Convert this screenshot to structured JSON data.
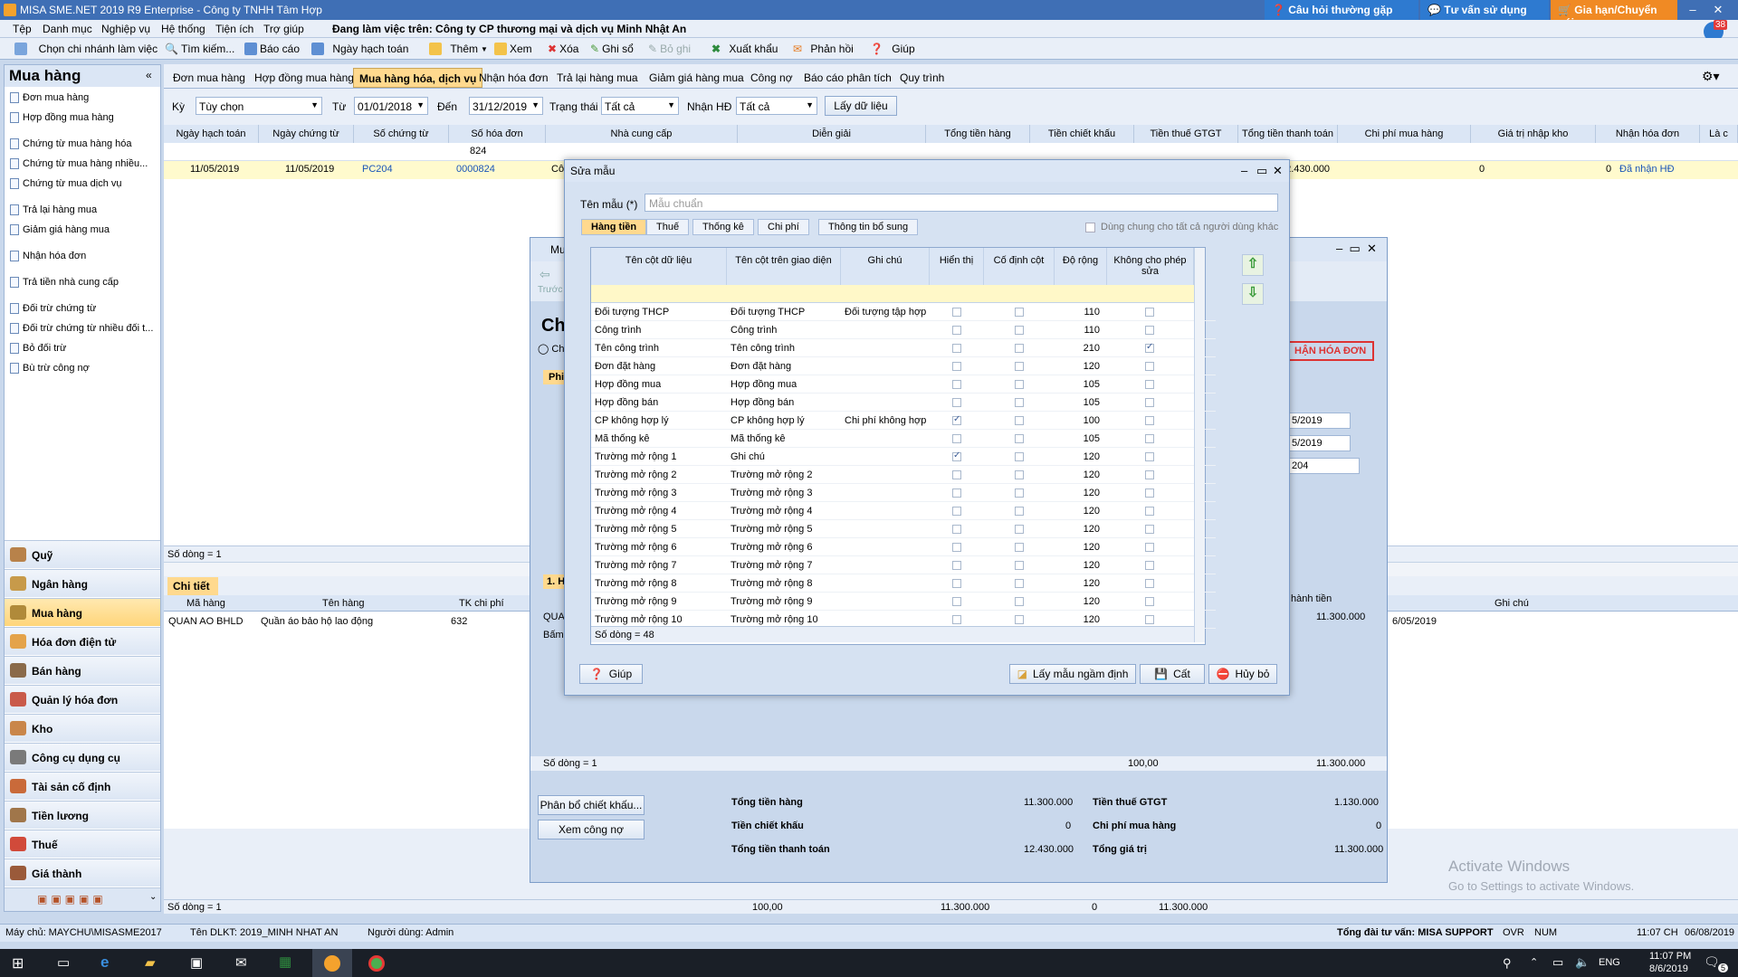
{
  "app": {
    "title": "MISA SME.NET 2019 R9 Enterprise - Công ty TNHH Tâm Hợp",
    "faq_label": "Câu hỏi thường gặp",
    "consult_label": "Tư vấn sử dụng",
    "renew_label": "Gia hạn/Chuyển gói",
    "working_on": "Đang làm việc trên: Công ty CP thương mại và dịch vụ Minh Nhật An",
    "notification_count": "38"
  },
  "menu": [
    "Tệp",
    "Danh mục",
    "Nghiệp vụ",
    "Hệ thống",
    "Tiện ích",
    "Trợ giúp"
  ],
  "toolbar": [
    "Chọn chi nhánh làm việc",
    "Tìm kiếm...",
    "Báo cáo",
    "Ngày hạch toán",
    "Thêm",
    "Xem",
    "Xóa",
    "Ghi sổ",
    "Bỏ ghi",
    "Xuất khẩu",
    "Phản hồi",
    "Giúp"
  ],
  "left": {
    "title": "Mua hàng",
    "items": [
      "Đơn mua hàng",
      "Hợp đồng mua hàng",
      "Chứng từ mua hàng hóa",
      "Chứng từ mua hàng nhiều...",
      "Chứng từ mua dịch vụ",
      "Trả lại hàng mua",
      "Giảm giá hàng mua",
      "Nhận hóa đơn",
      "Trả tiền nhà cung cấp",
      "Đối trừ chứng từ",
      "Đối trừ chứng từ nhiều đối t...",
      "Bỏ đối trừ",
      "Bù trừ công nợ"
    ],
    "modules": [
      "Quỹ",
      "Ngân hàng",
      "Mua hàng",
      "Hóa đơn điện tử",
      "Bán hàng",
      "Quản lý hóa đơn",
      "Kho",
      "Công cụ dụng cụ",
      "Tài sản cố định",
      "Tiền lương",
      "Thuế",
      "Giá thành"
    ]
  },
  "tabs": [
    "Đơn mua hàng",
    "Hợp đồng mua hàng",
    "Mua hàng hóa, dịch vụ",
    "Nhận hóa đơn",
    "Trả lại hàng mua",
    "Giảm giá hàng mua",
    "Công nợ",
    "Báo cáo phân tích",
    "Quy trình"
  ],
  "filter": {
    "ky_label": "Kỳ",
    "ky_value": "Tùy chọn",
    "tu_label": "Từ",
    "tu_value": "01/01/2018",
    "den_label": "Đến",
    "den_value": "31/12/2019",
    "trangthai_label": "Trạng thái",
    "trangthai_value": "Tất cả",
    "nhanhd_label": "Nhận HĐ",
    "nhanhd_value": "Tất cả",
    "load_button": "Lấy dữ liệu"
  },
  "main_grid": {
    "headers": [
      "Ngày hạch toán",
      "Ngày chứng từ",
      "Số chứng từ",
      "Số hóa đơn",
      "Nhà cung cấp",
      "Diễn giải",
      "Tổng tiền hàng",
      "Tiền chiết khấu",
      "Tiền thuế GTGT",
      "Tổng tiền thanh toán",
      "Chi phí mua hàng",
      "Giá trị nhập kho",
      "Nhận hóa đơn",
      "Là c"
    ],
    "filter_invoice": "824",
    "row": [
      "11/05/2019",
      "11/05/2019",
      "PC204",
      "0000824",
      "Cô",
      "12.430.000",
      "0",
      "0",
      "Đã nhận HĐ"
    ],
    "row_count": "Số dòng = 1"
  },
  "detail": {
    "tab": "Chi tiết",
    "headers": [
      "Mã hàng",
      "Tên hàng",
      "TK chi phí",
      "Ghi chú"
    ],
    "row": [
      "QUAN AO BHLD",
      "Quần áo bảo hộ lao động",
      "632",
      "6/05/2019"
    ],
    "footer": [
      "Số dòng = 1",
      "100,00",
      "11.300.000",
      "0",
      "11.300.000"
    ]
  },
  "bg_dialog": {
    "title": "Mu",
    "back": "Trước",
    "heading": "Ch",
    "radio": "Ch",
    "phi": "Phi",
    "red_button": "HẬN HÓA ĐƠN",
    "date1": "5/2019",
    "date2": "5/2019",
    "num": "204",
    "tab1": "1. H",
    "col_header": "hành tiền",
    "qua": "QUA",
    "bam": "Bấm",
    "amount": "11.300.000",
    "row_count": "Số dòng = 1",
    "sum_qty": "100,00",
    "sum_amt": "11.300.000",
    "alloc_button": "Phân bổ chiết khấu...",
    "debt_button": "Xem công nợ",
    "totals": [
      {
        "label": "Tổng tiền hàng",
        "value": "11.300.000"
      },
      {
        "label": "Tiền chiết khấu",
        "value": "0"
      },
      {
        "label": "Tổng tiền thanh toán",
        "value": "12.430.000"
      },
      {
        "label": "Tiền thuế GTGT",
        "value": "1.130.000"
      },
      {
        "label": "Chi phí mua hàng",
        "value": "0"
      },
      {
        "label": "Tổng giá trị",
        "value": "11.300.000"
      }
    ]
  },
  "dialog": {
    "title": "Sửa mẫu",
    "name_label": "Tên mẫu (*)",
    "name_value": "Mẫu chuẩn",
    "share_label": "Dùng chung cho tất cả người dùng khác",
    "tabs": [
      "Hàng tiền",
      "Thuế",
      "Thống kê",
      "Chi phí",
      "Thông tin bổ sung"
    ],
    "headers": [
      "Tên cột dữ liệu",
      "Tên cột trên giao diện",
      "Ghi chú",
      "Hiển thị",
      "Cố định cột",
      "Độ rộng",
      "Không cho phép sửa"
    ],
    "rows": [
      [
        "Đối tượng THCP",
        "Đối tượng THCP",
        "Đối tượng tập hợp",
        "0",
        "0",
        "110",
        "0"
      ],
      [
        "Công trình",
        "Công trình",
        "",
        "0",
        "0",
        "110",
        "0"
      ],
      [
        "Tên công trình",
        "Tên công trình",
        "",
        "0",
        "0",
        "210",
        "1"
      ],
      [
        "Đơn đặt hàng",
        "Đơn đặt hàng",
        "",
        "0",
        "0",
        "120",
        "0"
      ],
      [
        "Hợp đồng mua",
        "Hợp đồng mua",
        "",
        "0",
        "0",
        "105",
        "0"
      ],
      [
        "Hợp đồng bán",
        "Hợp đồng bán",
        "",
        "0",
        "0",
        "105",
        "0"
      ],
      [
        "CP không hợp lý",
        "CP không hợp lý",
        "Chi phí không hợp",
        "1",
        "0",
        "100",
        "0"
      ],
      [
        "Mã thống kê",
        "Mã thống kê",
        "",
        "0",
        "0",
        "105",
        "0"
      ],
      [
        "Trường mở rộng 1",
        "Ghi chú",
        "",
        "1",
        "0",
        "120",
        "0"
      ],
      [
        "Trường mở rộng 2",
        "Trường mở rộng 2",
        "",
        "0",
        "0",
        "120",
        "0"
      ],
      [
        "Trường mở rộng 3",
        "Trường mở rộng 3",
        "",
        "0",
        "0",
        "120",
        "0"
      ],
      [
        "Trường mở rộng 4",
        "Trường mở rộng 4",
        "",
        "0",
        "0",
        "120",
        "0"
      ],
      [
        "Trường mở rộng 5",
        "Trường mở rộng 5",
        "",
        "0",
        "0",
        "120",
        "0"
      ],
      [
        "Trường mở rộng 6",
        "Trường mở rộng 6",
        "",
        "0",
        "0",
        "120",
        "0"
      ],
      [
        "Trường mở rộng 7",
        "Trường mở rộng 7",
        "",
        "0",
        "0",
        "120",
        "0"
      ],
      [
        "Trường mở rộng 8",
        "Trường mở rộng 8",
        "",
        "0",
        "0",
        "120",
        "0"
      ],
      [
        "Trường mở rộng 9",
        "Trường mở rộng 9",
        "",
        "0",
        "0",
        "120",
        "0"
      ],
      [
        "Trường mở rộng 10",
        "Trường mở rộng 10",
        "",
        "0",
        "0",
        "120",
        "0"
      ]
    ],
    "row_count": "Số dòng = 48",
    "help": "Giúp",
    "default_button": "Lấy mẫu ngầm định",
    "save_button": "Cất",
    "cancel_button": "Hủy bỏ"
  },
  "watermark": {
    "line1": "Activate Windows",
    "line2": "Go to Settings to activate Windows."
  },
  "status": {
    "server": "Máy chủ: MAYCHU\\MISASME2017",
    "db": "Tên DLKT: 2019_MINH NHAT AN",
    "user": "Người dùng: Admin",
    "support": "Tổng đài tư vấn: MISA SUPPORT",
    "ovr": "OVR",
    "num": "NUM",
    "time": "11:07 CH",
    "date": "06/08/2019",
    "footer_count": "Số dòng = 1",
    "f1": "100,00",
    "f2": "11.300.000",
    "f3": "0",
    "f4": "11.300.000"
  },
  "taskbar": {
    "lang": "ENG",
    "time": "11:07 PM",
    "date": "8/6/2019",
    "badge": "5"
  }
}
